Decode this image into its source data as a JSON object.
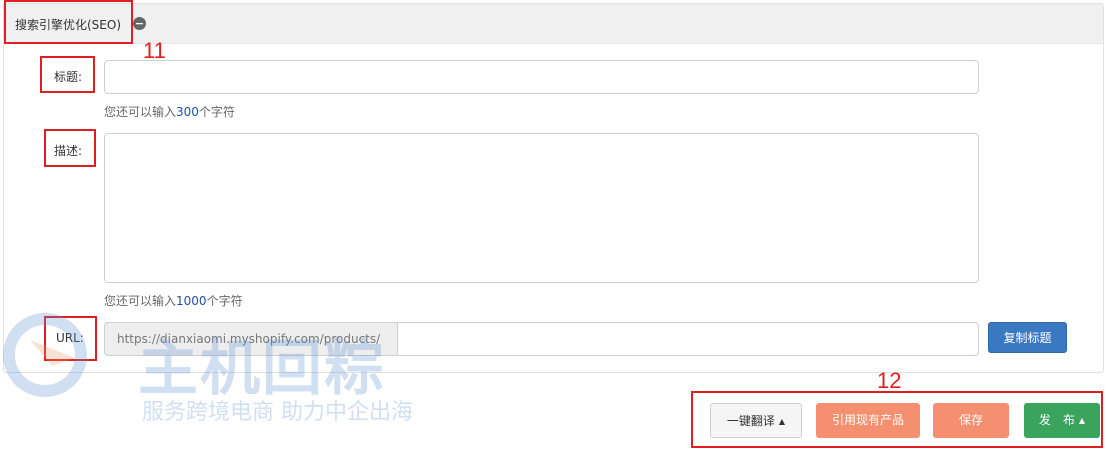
{
  "seo": {
    "title": "搜索引擎优化(SEO)",
    "collapse_icon": "minus-circle-icon"
  },
  "annotations": {
    "a11": "11",
    "a12": "12"
  },
  "fields": {
    "title_label": "标题:",
    "title_hint_pre": "您还可以输入",
    "title_hint_num": "300",
    "title_hint_post": "个字符",
    "desc_label": "描述:",
    "desc_hint_pre": "您还可以输入",
    "desc_hint_num": "1000",
    "desc_hint_post": "个字符",
    "url_label": "URL:",
    "url_prefix": "https://dianxiaomi.myshopify.com/products/",
    "copy_title_btn": "复制标题"
  },
  "actions": {
    "translate": "一键翻译",
    "quote_existing": "引用现有产品",
    "save": "保存",
    "publish": "发　布"
  },
  "watermark": {
    "main": "主机回粽",
    "sub": "服务跨境电商 助力中企出海"
  },
  "colors": {
    "annotation_red": "#e02020",
    "copy_blue": "#3a78c2",
    "orange": "#f4906f",
    "green": "#3aa35c"
  }
}
